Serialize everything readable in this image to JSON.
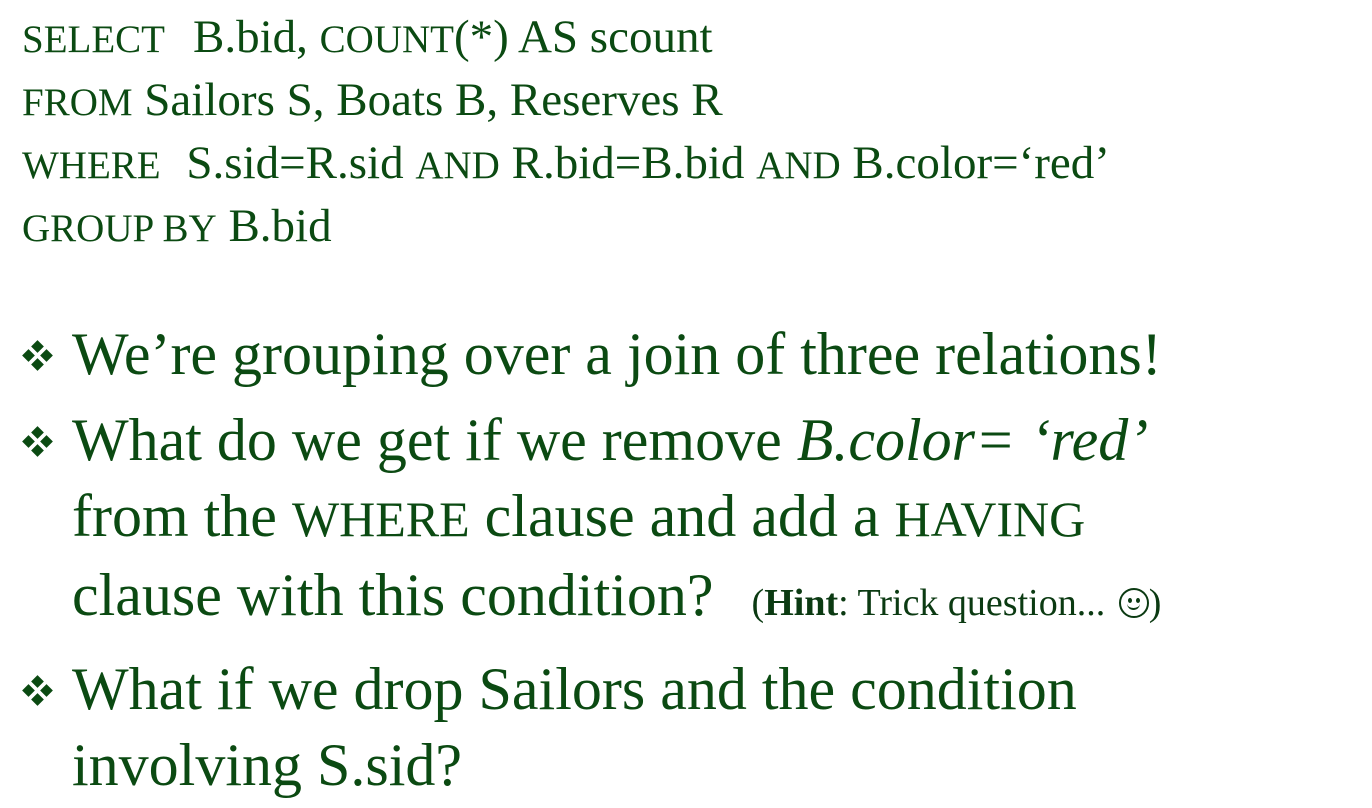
{
  "sql": {
    "select_kw": "SELECT",
    "select_cols": "B.bid,",
    "count_kw": "COUNT",
    "count_rest": "(*) AS scount",
    "from_kw": "FROM",
    "from_tables": "Sailors S, Boats B, Reserves R",
    "where_kw": "WHERE",
    "where_cond1": "S.sid=R.sid",
    "and1_kw": "AND",
    "where_cond2": "R.bid=B.bid",
    "and2_kw": "AND",
    "where_cond3": "B.color=‘red’",
    "groupby_kw": "GROUP BY",
    "groupby_col": "B.bid"
  },
  "bullets": {
    "b1": "We’re grouping over a join of three relations!",
    "b2_part1": "What do we get if we remove ",
    "b2_italic": "B.color= ‘red’",
    "b2_line2_pre": "from the ",
    "b2_where": "WHERE",
    "b2_line2_mid": " clause and add a ",
    "b2_having": "HAVING",
    "b2_line3": "clause with this condition?",
    "hint_open": "(",
    "hint_label": "Hint",
    "hint_text": ": Trick question... ",
    "hint_close": ")",
    "b3_line1": "What if we drop Sailors and the condition",
    "b3_line2": "involving S.sid?"
  },
  "colors": {
    "text": "#0b4a12",
    "background": "#ffffff"
  },
  "icons": {
    "bullet": "four-diamond-bullet-icon",
    "hint_emoji": "smiley-face-icon"
  }
}
